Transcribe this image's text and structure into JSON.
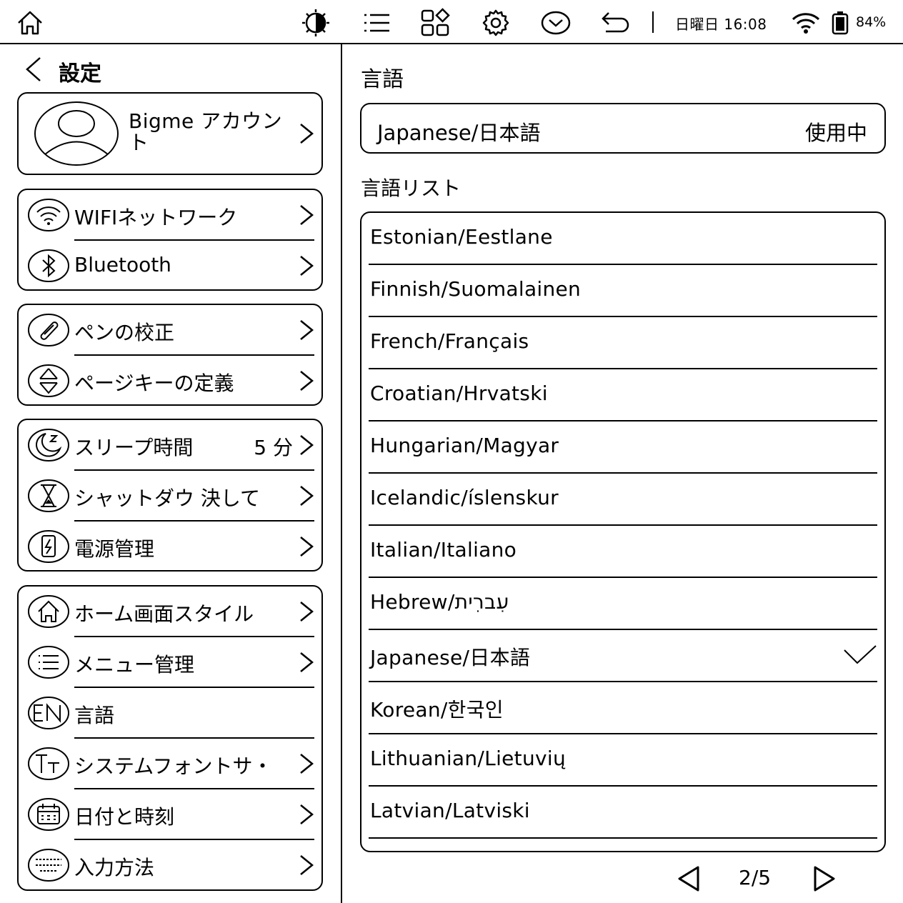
{
  "status_bar": {
    "icons": [
      "home-icon",
      "contrast-icon",
      "menu-list-icon",
      "apps-grid-icon",
      "settings-gear-icon",
      "chevron-circle-icon",
      "back-return-icon",
      "wifi-icon",
      "battery-icon"
    ],
    "datetime": "日曜日 16:08",
    "battery": "84%"
  },
  "left_panel": {
    "title": "設定",
    "account": {
      "label": "Bigme アカウント",
      "icon": "user-avatar-icon"
    },
    "groups": [
      [
        {
          "label": "WIFIネットワーク",
          "icon": "wifi-icon",
          "chevron": true
        },
        {
          "label": "Bluetooth",
          "icon": "bluetooth-icon",
          "chevron": true
        }
      ],
      [
        {
          "label": "ペンの校正",
          "icon": "pen-calibration-icon",
          "chevron": true
        },
        {
          "label": "ページキーの定義",
          "icon": "page-keys-icon",
          "chevron": true
        }
      ],
      [
        {
          "label": "スリープ時間",
          "value": "5 分",
          "icon": "sleep-moon-icon",
          "chevron": true
        },
        {
          "label": "シャットダウ 決して",
          "icon": "hourglass-icon",
          "chevron": true
        },
        {
          "label": "電源管理",
          "icon": "power-battery-icon",
          "chevron": true
        }
      ],
      [
        {
          "label": "ホーム画面スタイル",
          "icon": "home-icon",
          "chevron": true
        },
        {
          "label": "メニュー管理",
          "icon": "menu-list-icon",
          "chevron": true
        },
        {
          "label": "言語",
          "icon": "language-en-icon",
          "chevron": false
        },
        {
          "label": "システムフォントサ・",
          "icon": "font-size-icon",
          "chevron": true
        },
        {
          "label": "日付と時刻",
          "icon": "calendar-icon",
          "chevron": true
        },
        {
          "label": "入力方法",
          "icon": "keyboard-icon",
          "chevron": true
        }
      ]
    ]
  },
  "right_panel": {
    "title": "言語",
    "current_language": "Japanese/日本語",
    "current_status": "使用中",
    "list_title": "言語リスト",
    "languages": [
      "Estonian/Eestlane",
      "Finnish/Suomalainen",
      "French/Français",
      "Croatian/Hrvatski",
      "Hungarian/Magyar",
      "Icelandic/íslenskur",
      "Italian/Italiano",
      "Hebrew/עִברִית",
      "Japanese/日本語",
      "Korean/한국인",
      "Lithuanian/Lietuvių",
      "Latvian/Latviski"
    ],
    "selected_index": 8,
    "pager": "2/5"
  }
}
